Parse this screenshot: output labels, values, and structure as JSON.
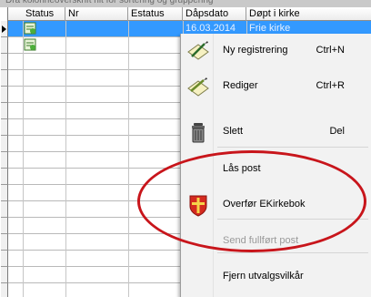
{
  "group_hint": "Dra kolonneoverskrift hit for sortering og gruppering",
  "columns": [
    "Status",
    "Nr",
    "Estatus",
    "Dåpsdato",
    "Døpt i kirke"
  ],
  "selected_row": {
    "dapsdato": "16.03.2014",
    "kirke": "Frie kirke"
  },
  "menu": {
    "new": {
      "label": "Ny registrering",
      "shortcut": "Ctrl+N"
    },
    "edit": {
      "label": "Rediger",
      "shortcut": "Ctrl+R"
    },
    "delete": {
      "label": "Slett",
      "shortcut": "Del"
    },
    "lock": {
      "label": "Lås post"
    },
    "transfer": {
      "label": "Overfør EKirkebok"
    },
    "send": {
      "label": "Send fullført post"
    },
    "remove": {
      "label": "Fjern utvalgsvilkår"
    }
  },
  "colors": {
    "selection": "#3399ff",
    "highlight_ellipse": "#c8151b"
  },
  "icons": [
    "pencil-new-icon",
    "pencil-edit-icon",
    "trash-icon",
    "church-cross-icon",
    "status-doc-icon"
  ]
}
